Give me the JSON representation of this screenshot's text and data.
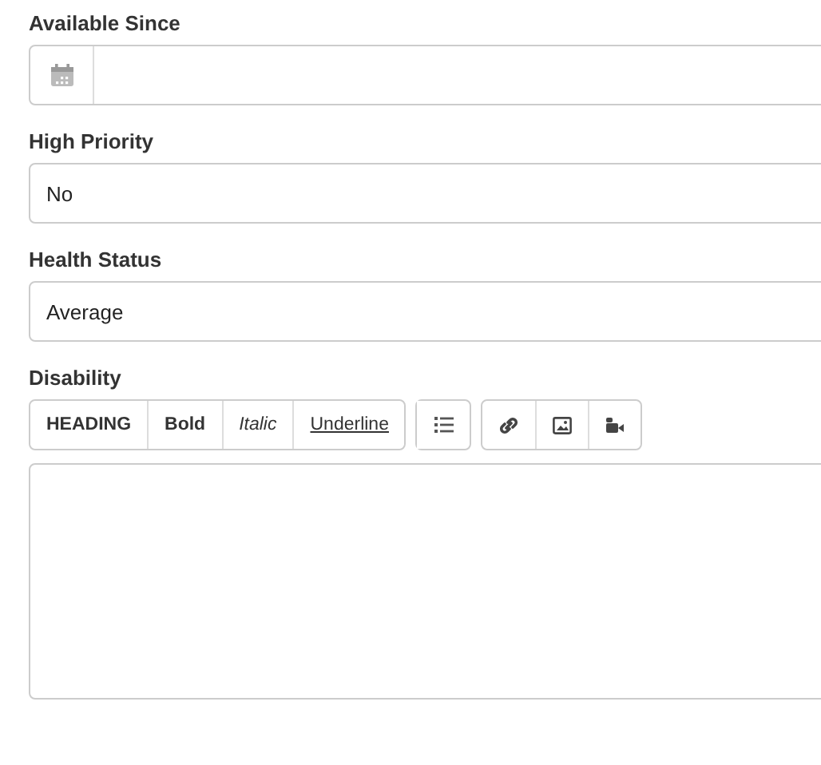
{
  "fields": [
    {
      "kind": "date",
      "label": "Available Since"
    },
    {
      "kind": "text",
      "label": "High Priority",
      "value": "No"
    },
    {
      "kind": "text",
      "label": "Health Status",
      "value": "Average"
    },
    {
      "kind": "editor",
      "label": "Disability",
      "toolbar": [
        [
          {
            "kind": "heading",
            "label": "HEADING"
          },
          {
            "kind": "bold",
            "label": "Bold"
          },
          {
            "kind": "italic",
            "label": "Italic"
          },
          {
            "kind": "underline",
            "label": "Underline"
          }
        ],
        [
          {
            "kind": "list"
          }
        ],
        [
          {
            "kind": "link"
          },
          {
            "kind": "image"
          },
          {
            "kind": "video"
          }
        ]
      ]
    }
  ]
}
